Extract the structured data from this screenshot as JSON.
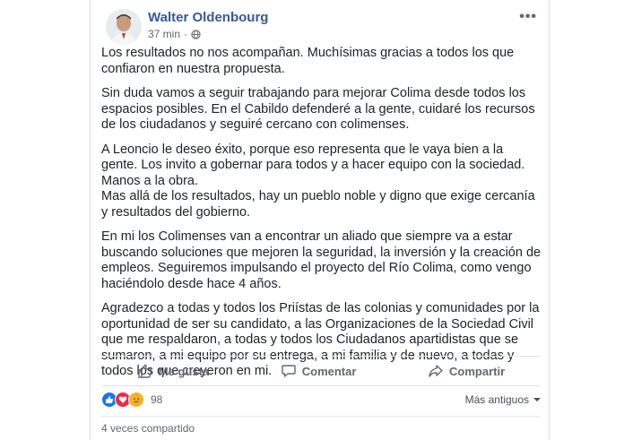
{
  "post": {
    "author": "Walter Oldenbourg",
    "time": "37 min",
    "separator": "·",
    "privacy_icon": "globe-icon",
    "more_icon": "more-options-icon",
    "paragraphs": [
      "Los resultados no nos acompañan. Muchísimas gracias a todos los que confiaron en nuestra propuesta.",
      "Sin duda vamos a seguir trabajando para mejorar Colima desde todos los espacios posibles. En el Cabildo defenderé a la gente, cuidaré los recursos de los ciudadanos y seguiré cercano con colimenses.",
      "A Leoncio le deseo éxito, porque eso representa que le vaya bien a la gente. Los invito a gobernar para todos y a hacer equipo con la sociedad. Manos a la obra.",
      "Mas allá de los resultados, hay un pueblo noble y digno que exige cercanía y resultados del gobierno.",
      "En mi los Colimenses van a encontrar un aliado que siempre va a estar buscando soluciones que mejoren la seguridad, la inversión y la creación de empleos. Seguiremos impulsando el proyecto del Río Colima, como vengo haciéndolo desde hace 4 años.",
      "Agradezco a todas y todos los Priístas de las colonias y comunidades por la oportunidad de ser su candidato, a las Organizaciones de la Sociedad Civil que me respaldaron, a todas y todos los Ciudadanos apartidistas que se sumaron, a mi equipo por su entrega, a mi familia y de nuevo, a todas y todos los que creyeron en mi."
    ]
  },
  "actions": {
    "like_label": "Me gusta",
    "comment_label": "Comentar",
    "share_label": "Compartir"
  },
  "reactions": {
    "icons": [
      "like-icon",
      "love-icon",
      "sad-icon"
    ],
    "count": "98",
    "sort_label": "Más antiguos"
  },
  "shares": {
    "label": "4 veces compartido"
  },
  "colors": {
    "author": "#365899",
    "text": "#1d2129",
    "muted": "#616770",
    "like": "#1877f2",
    "love": "#f0284a",
    "sad": "#f7b125"
  }
}
